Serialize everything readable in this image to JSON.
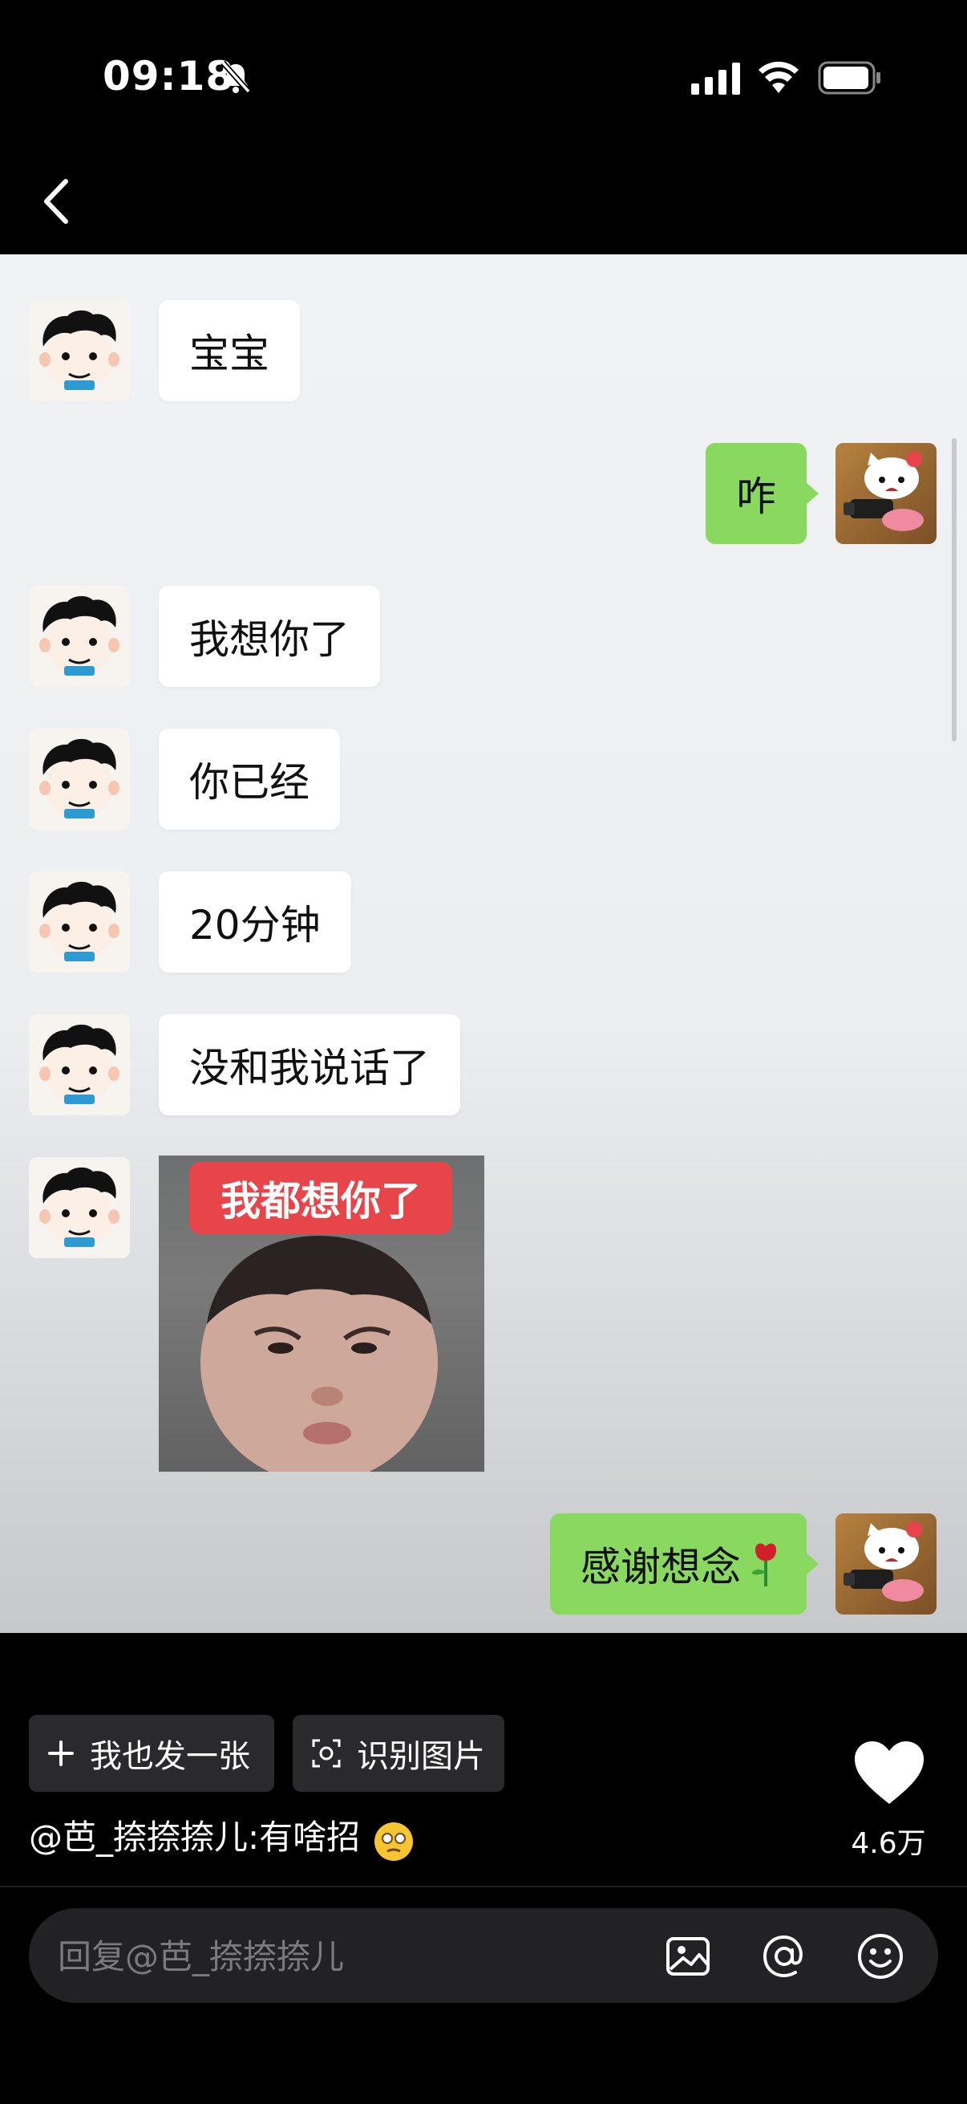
{
  "status_bar": {
    "time": "09:18",
    "icons": [
      "bell-mute-icon",
      "signal-icon",
      "wifi-icon",
      "battery-icon"
    ]
  },
  "nav": {
    "back_icon": "chevron-left-icon"
  },
  "chat": {
    "messages": [
      {
        "side": "in",
        "text": "宝宝"
      },
      {
        "side": "out",
        "text": "咋"
      },
      {
        "side": "in",
        "text": "我想你了"
      },
      {
        "side": "in",
        "text": "你已经"
      },
      {
        "side": "in",
        "text": "20分钟"
      },
      {
        "side": "in",
        "text": "没和我说话了"
      },
      {
        "side": "in",
        "type": "sticker",
        "caption": "我都想你了"
      },
      {
        "side": "out",
        "text": "感谢想念"
      }
    ],
    "colors": {
      "out_bubble": "#89d961",
      "in_bubble": "#ffffff",
      "sticker_caption": "#e8454a"
    }
  },
  "actions": {
    "post_too": "我也发一张",
    "recognize": "识别图片"
  },
  "caption": "@芭_捺捺捺儿:有啥招",
  "likes": {
    "count": "4.6万"
  },
  "reply": {
    "placeholder": "回复@芭_捺捺捺儿",
    "icons": [
      "image-icon",
      "at-icon",
      "emoji-icon"
    ]
  }
}
